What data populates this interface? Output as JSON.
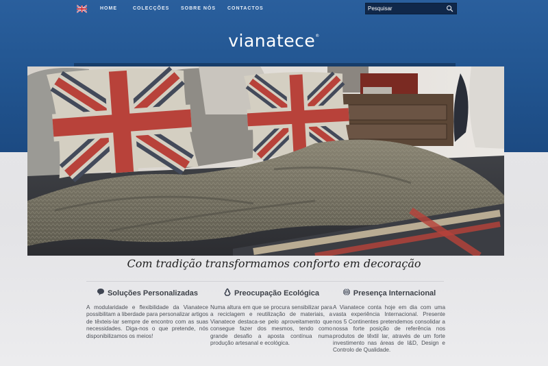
{
  "nav": {
    "language_flag": "uk-flag-icon",
    "items": [
      "HOME",
      "COLECÇÕES",
      "SOBRE NÓS",
      "CONTACTOS"
    ]
  },
  "search": {
    "placeholder": "Pesquisar",
    "icon": "magnifier-icon"
  },
  "brand": {
    "logo_text": "vianatece",
    "registered_mark": "®"
  },
  "hero": {
    "description": "bed with union jack cushions and knit throw"
  },
  "tagline": "Com tradição transformamos conforto em decoração",
  "features": [
    {
      "icon": "speech-bubble-icon",
      "title": "Soluções Personalizadas",
      "text": "A modularidade e flexibilidade da Vianatece possibilitam a liberdade para personalizar artigos de têxteis-lar sempre de encontro com as suas necessidades. Diga-nos o que pretende, nós disponibilizamos os meios!"
    },
    {
      "icon": "recycle-icon",
      "title": "Preocupação Ecológica",
      "text": "Numa altura em que se procura sensibilizar para a reciclagem e reutilização de materiais, a Vianatece destaca-se pelo aproveitamento que consegue fazer dos mesmos, tendo como grande desafio a aposta contínua numa produção artesanal e ecológica."
    },
    {
      "icon": "globe-icon",
      "title": "Presença Internacional",
      "text": "A Vianatece conta hoje em dia com uma vasta experiência Internacional. Presente nos 5 Continentes pretendemos consolidar a nossa forte posição de referência nos produtos de têxtil lar, através de um forte investimento nas áreas de I&D, Design e Controlo de Qualidade."
    }
  ],
  "colors": {
    "header_blue": "#21548f",
    "search_bg": "#10284a",
    "text": "#4b4f56"
  }
}
